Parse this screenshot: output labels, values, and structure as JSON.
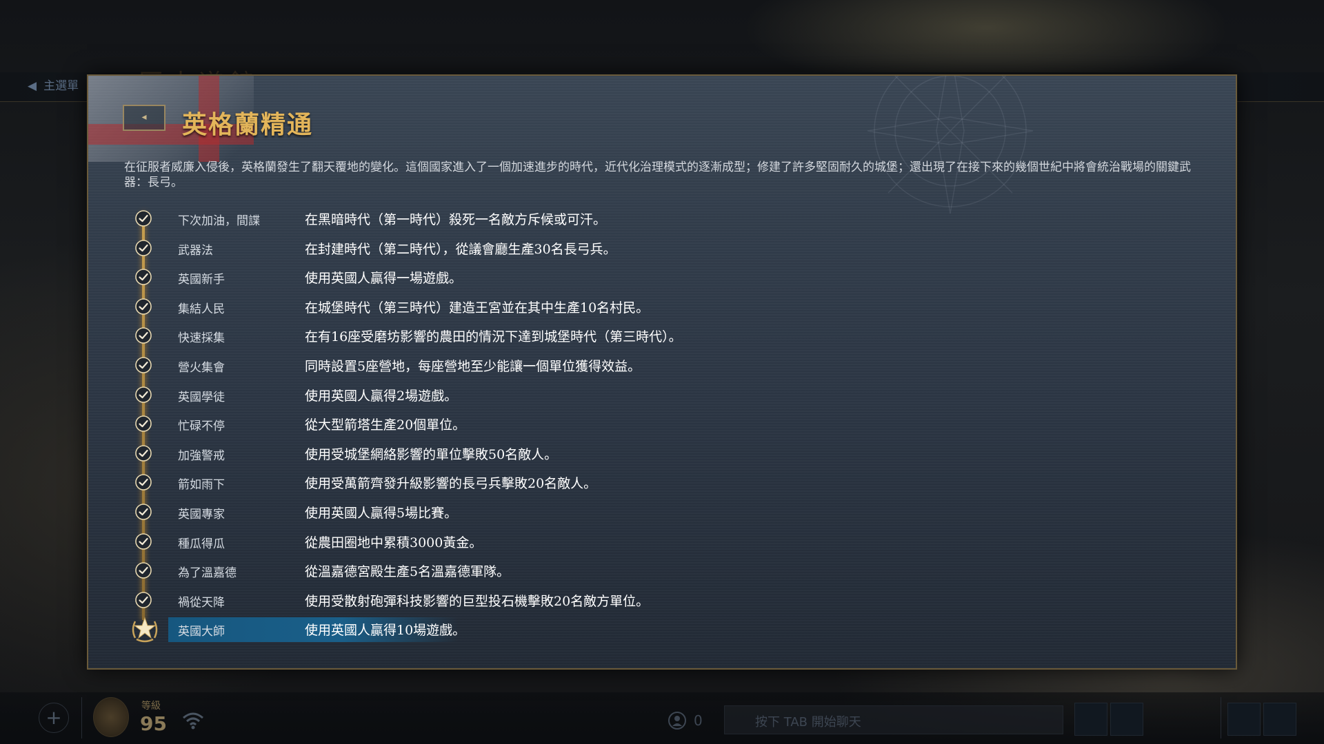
{
  "background": {
    "main_menu_label": "主選單",
    "bg_title": "歷史道館"
  },
  "bottom_bar": {
    "level_label": "等級",
    "level_value": "95",
    "friends_count": "0",
    "chat_placeholder": "按下 TAB 開始聊天"
  },
  "panel": {
    "back_label": "<",
    "title": "英格蘭精通",
    "description": "在征服者威廉入侵後，英格蘭發生了翻天覆地的變化。這個國家進入了一個加速進步的時代，近代化治理模式的逐漸成型；修建了許多堅固耐久的城堡；還出現了在接下來的幾個世紀中將會統治戰場的關鍵武器：長弓。",
    "achievements": [
      {
        "name": "下次加油，間諜",
        "desc": "在黑暗時代（第一時代）殺死一名敵方斥候或可汗。",
        "completed": true
      },
      {
        "name": "武器法",
        "desc": "在封建時代（第二時代），從議會廳生產30名長弓兵。",
        "completed": true
      },
      {
        "name": "英國新手",
        "desc": "使用英國人贏得一場遊戲。",
        "completed": true
      },
      {
        "name": "集結人民",
        "desc": "在城堡時代（第三時代）建造王宮並在其中生產10名村民。",
        "completed": true
      },
      {
        "name": "快速採集",
        "desc": "在有16座受磨坊影響的農田的情況下達到城堡時代（第三時代）。",
        "completed": true
      },
      {
        "name": "營火集會",
        "desc": "同時設置5座營地，每座營地至少能讓一個單位獲得效益。",
        "completed": true
      },
      {
        "name": "英國學徒",
        "desc": "使用英國人贏得2場遊戲。",
        "completed": true
      },
      {
        "name": "忙碌不停",
        "desc": "從大型箭塔生產20個單位。",
        "completed": true
      },
      {
        "name": "加強警戒",
        "desc": "使用受城堡網絡影響的單位擊敗50名敵人。",
        "completed": true
      },
      {
        "name": "箭如雨下",
        "desc": "使用受萬箭齊發升級影響的長弓兵擊敗20名敵人。",
        "completed": true
      },
      {
        "name": "英國專家",
        "desc": "使用英國人贏得5場比賽。",
        "completed": true
      },
      {
        "name": "種瓜得瓜",
        "desc": "從農田圈地中累積3000黃金。",
        "completed": true
      },
      {
        "name": "為了溫嘉德",
        "desc": "從溫嘉德宮殿生產5名溫嘉德軍隊。",
        "completed": true
      },
      {
        "name": "禍從天降",
        "desc": "使用受散射砲彈科技影響的巨型投石機擊敗20名敵方單位。",
        "completed": true
      },
      {
        "name": "英國大師",
        "desc": "使用英國人贏得10場遊戲。",
        "completed": true,
        "highlighted": true
      }
    ]
  },
  "colors": {
    "title_gold": "#e3b55a",
    "highlight_blue": "#1a5f89",
    "panel_border": "#6a5a3a"
  },
  "icons": {
    "check": "check-circle-icon",
    "mastery": "star-laurel-icon"
  }
}
